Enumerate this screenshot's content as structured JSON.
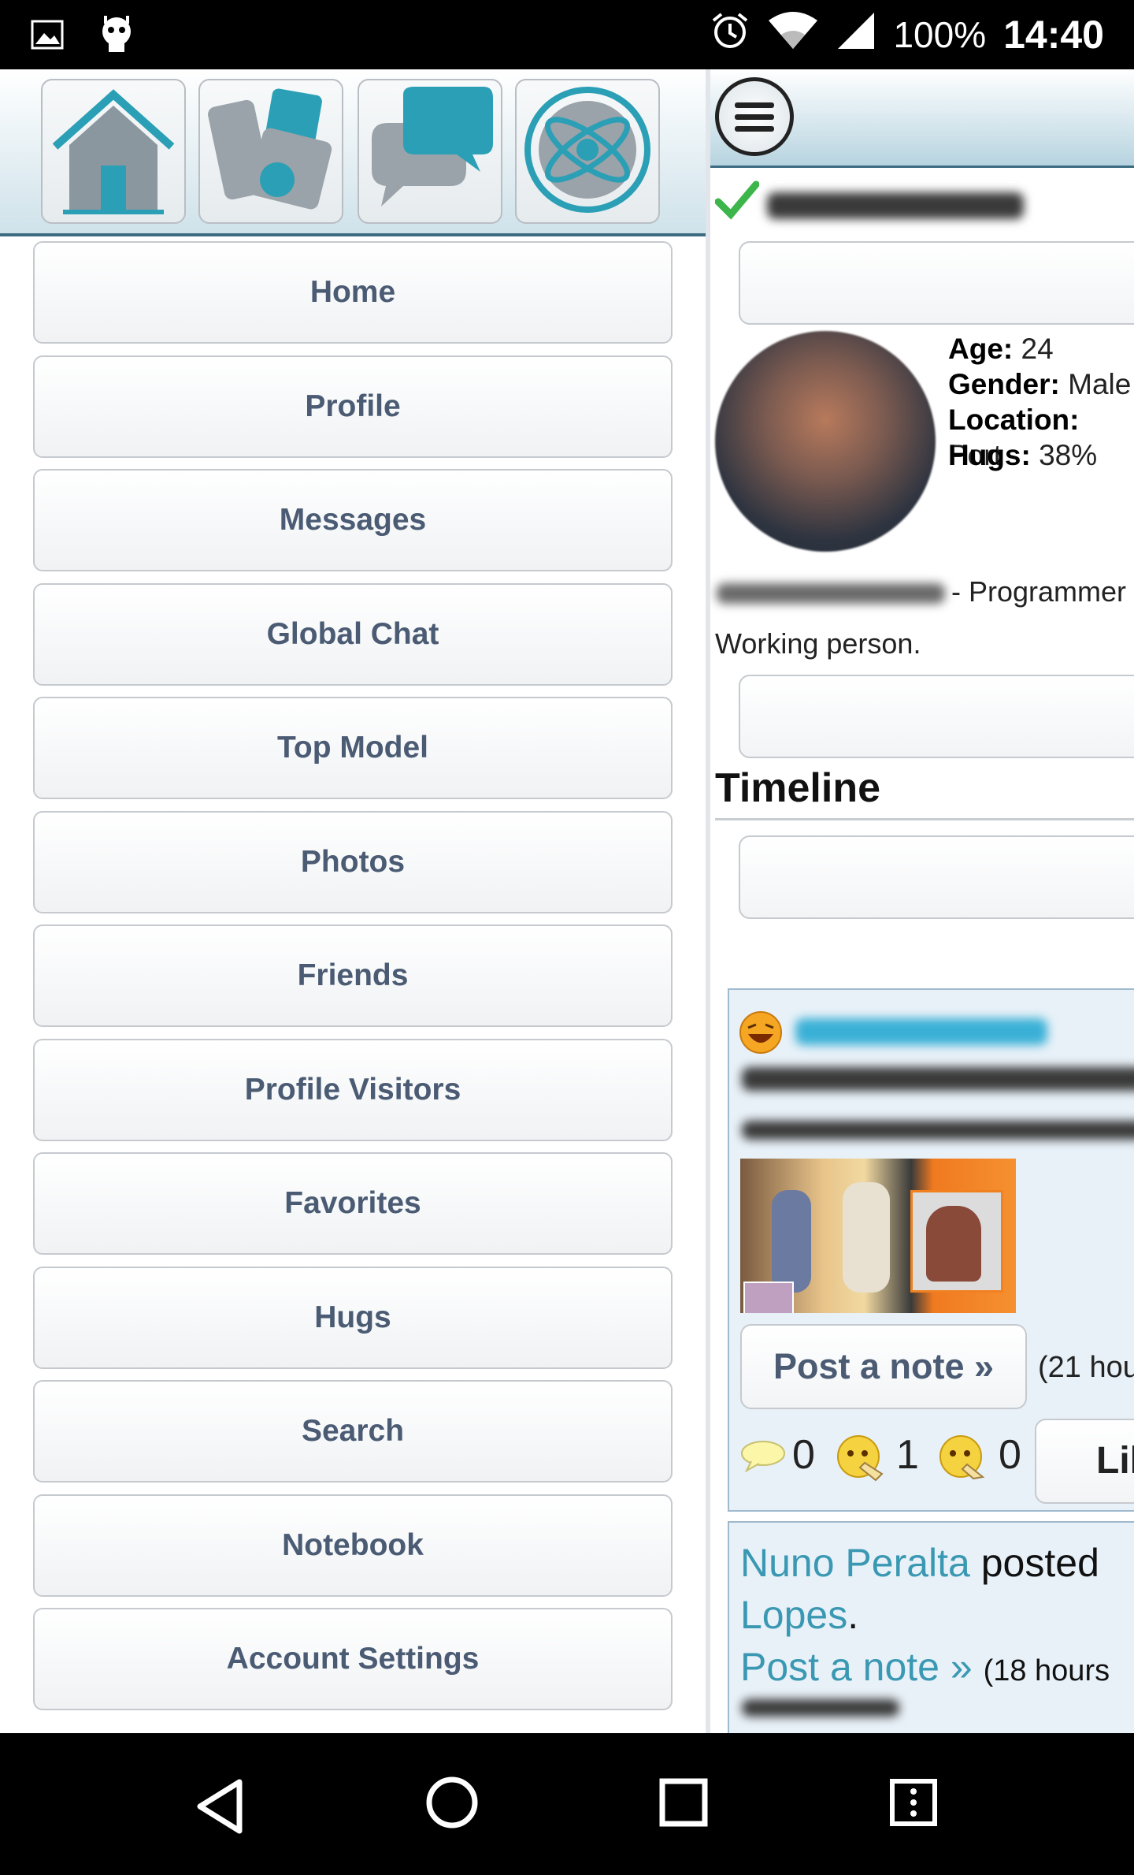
{
  "status_bar": {
    "battery": "100%",
    "time": "14:40",
    "icons": [
      "image-icon",
      "android-icon",
      "alarm-icon",
      "wifi-icon",
      "signal-icon"
    ]
  },
  "drawer": {
    "tab_icons": [
      "home-icon",
      "games-icon",
      "chat-icon",
      "planet-icon"
    ],
    "menu_items": [
      "Home",
      "Profile",
      "Messages",
      "Global Chat",
      "Top Model",
      "Photos",
      "Friends",
      "Profile Visitors",
      "Favorites",
      "Hugs",
      "Search",
      "Notebook",
      "Account Settings"
    ]
  },
  "profile": {
    "age_label": "Age:",
    "age_value": " 24",
    "gender_label": "Gender:",
    "gender_value": " Male",
    "location_label": "Location:",
    "location_value": " Port",
    "hugs_label": "Hugs:",
    "hugs_value": " 38%",
    "occupation": "- Programmer",
    "bio": "Working person."
  },
  "timeline": {
    "title": "Timeline",
    "post1": {
      "post_note_label": "Post a note »",
      "time": "(21 hou",
      "comments": "0",
      "likes": "1",
      "dislikes": "0",
      "like_button": "Lil"
    },
    "post2": {
      "author": "Nuno Peralta",
      "verb": " posted",
      "target": "Lopes",
      "post_note_link": "Post a note »",
      "time": "(18 hours"
    }
  },
  "colors": {
    "accent": "#2a9fb5",
    "menu_text": "#4a5b73",
    "header_border": "#3c6c82"
  }
}
